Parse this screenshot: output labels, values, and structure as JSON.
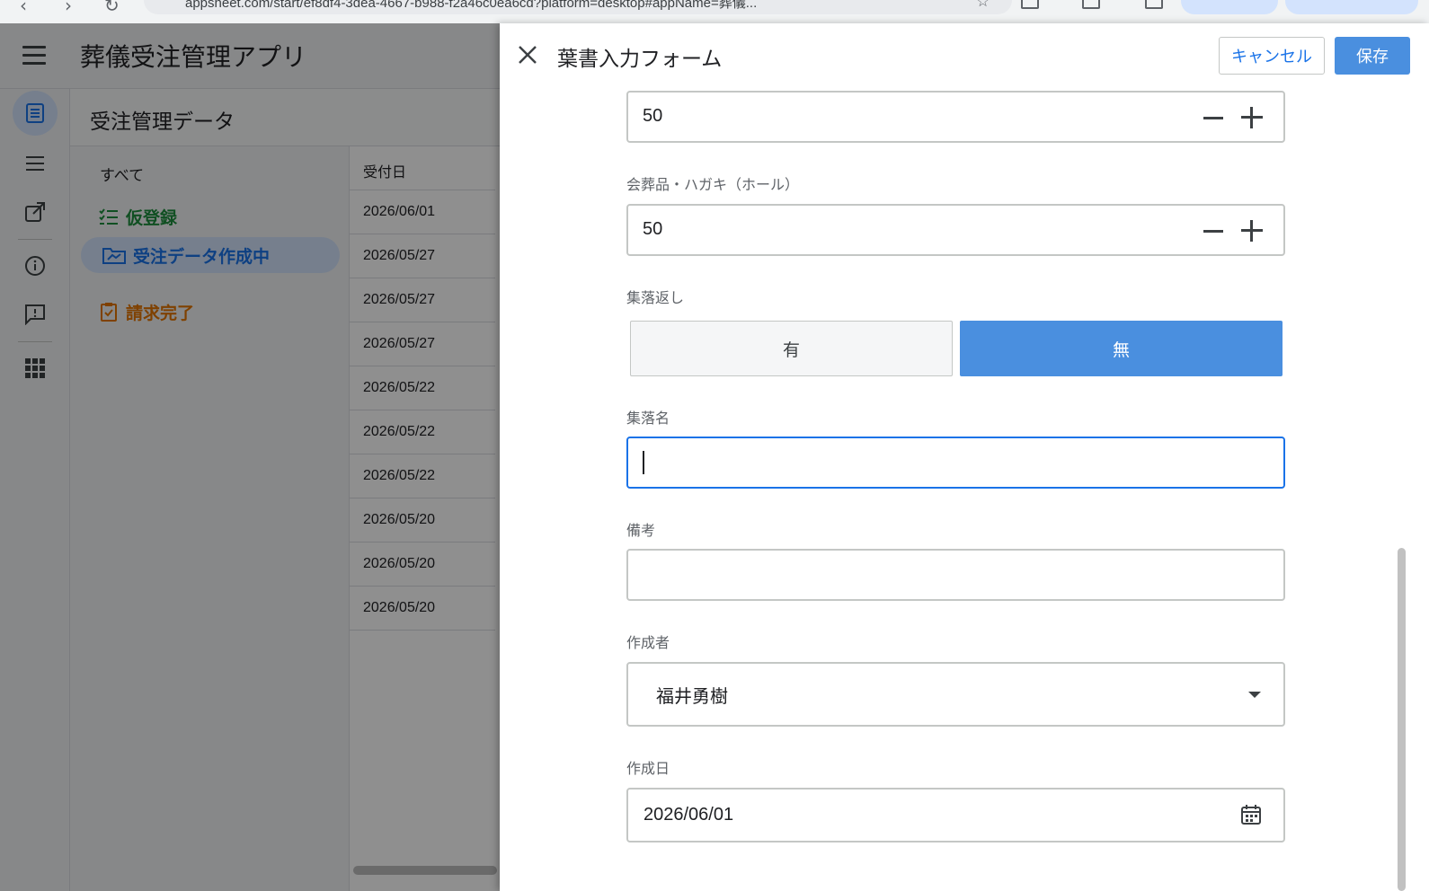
{
  "browser": {
    "url": "appsheet.com/start/ef8df4-3dea-4667-b988-f2a46c0ea6cd?platform=desktop#appName=葬儀..."
  },
  "app": {
    "title": "葬儀受注管理アプリ",
    "view_title": "受注管理データ"
  },
  "rail": {
    "items": [
      "list-view-icon",
      "menu-lines-icon",
      "external-link-icon",
      "info-icon",
      "feedback-icon",
      "apps-grid-icon"
    ]
  },
  "filters": {
    "all_label": "すべて",
    "items": [
      {
        "label": "仮登録",
        "color": "#1e8e3e"
      },
      {
        "label": "受注データ作成中",
        "color": "#1a73e8"
      },
      {
        "label": "請求完了",
        "color": "#e37400"
      }
    ]
  },
  "table": {
    "header": "受付日",
    "rows": [
      "2026/06/01",
      "2026/05/27",
      "2026/05/27",
      "2026/05/27",
      "2026/05/22",
      "2026/05/22",
      "2026/05/22",
      "2026/05/20",
      "2026/05/20",
      "2026/05/20"
    ]
  },
  "form": {
    "title": "葉書入力フォーム",
    "cancel_label": "キャンセル",
    "save_label": "保存",
    "top_number_value": "50",
    "hall_postcard": {
      "label": "会葬品・ハガキ（ホール）",
      "value": "50"
    },
    "village_return": {
      "label": "集落返し",
      "options": [
        "有",
        "無"
      ],
      "selected": "無"
    },
    "village_name": {
      "label": "集落名",
      "value": ""
    },
    "remarks": {
      "label": "備考",
      "value": ""
    },
    "creator": {
      "label": "作成者",
      "value": "福井勇樹"
    },
    "created_date": {
      "label": "作成日",
      "value": "2026/06/01"
    }
  },
  "colors": {
    "primary": "#4a8fdf",
    "focus_border": "#1a73e8"
  }
}
